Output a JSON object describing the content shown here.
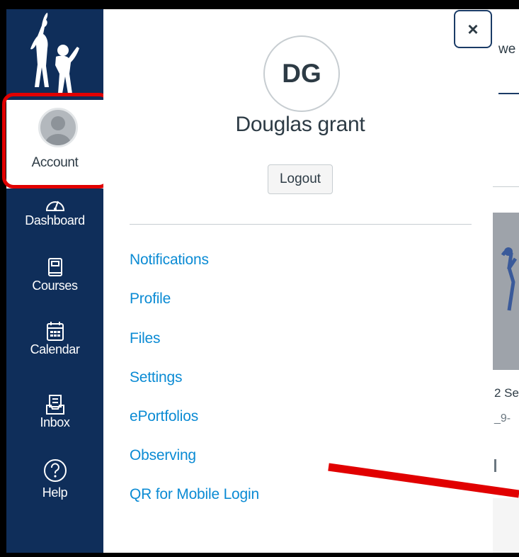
{
  "global_nav": {
    "items": [
      {
        "label": "Account",
        "icon": "person-avatar-icon"
      },
      {
        "label": "Dashboard",
        "icon": "dashboard-gauge-icon"
      },
      {
        "label": "Courses",
        "icon": "book-icon"
      },
      {
        "label": "Calendar",
        "icon": "calendar-icon"
      },
      {
        "label": "Inbox",
        "icon": "inbox-icon"
      },
      {
        "label": "Help",
        "icon": "help-circle-icon"
      }
    ],
    "bg_color": "#0f2e5a"
  },
  "tray": {
    "close_label": "×",
    "initials": "DG",
    "user_name": "Douglas grant",
    "logout_label": "Logout",
    "links": [
      "Notifications",
      "Profile",
      "Files",
      "Settings",
      "ePortfolios",
      "Observing",
      "QR for Mobile Login"
    ],
    "link_color": "#0b8bd4"
  },
  "background_app": {
    "header_fragment": "we",
    "card_title_fragment": "2 Se",
    "card_sub_fragment": "_9-"
  },
  "annotation": {
    "highlight_color": "#e10000"
  }
}
